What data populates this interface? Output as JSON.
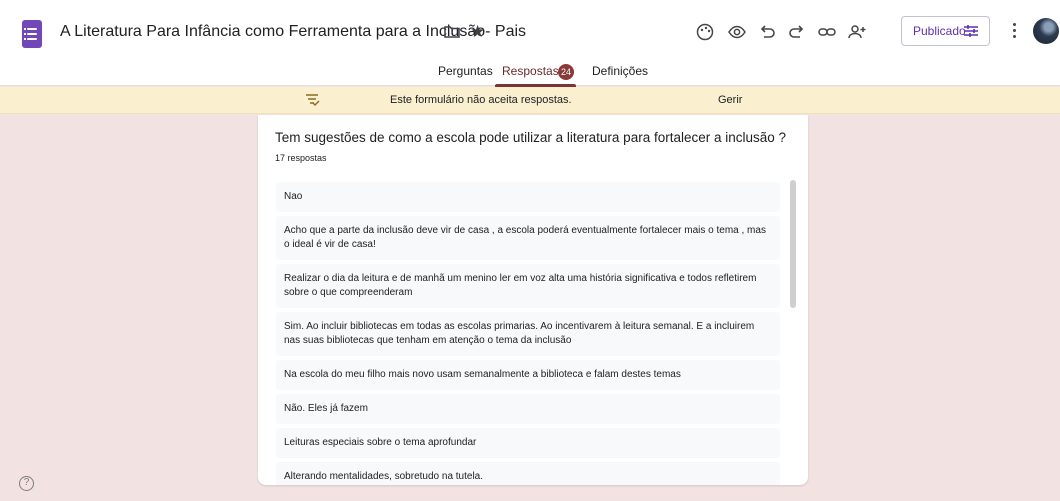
{
  "header": {
    "doc_title": "A Literatura Para  Infância como Ferramenta para a Inclusão- Pais",
    "publish_label": "Publicado"
  },
  "tabs": [
    {
      "label": "Perguntas"
    },
    {
      "label": "Respostas",
      "badge": "24",
      "active": true
    },
    {
      "label": "Definições"
    }
  ],
  "banner": {
    "message": "Este formulário não aceita respostas.",
    "action": "Gerir"
  },
  "question": {
    "title": "Tem sugestões de como a escola pode utilizar a literatura para fortalecer a inclusão ?",
    "count": "17 respostas",
    "answers": [
      "Nao",
      "Acho que a parte da inclusão deve vir de casa , a escola poderá eventualmente fortalecer mais o tema , mas o ideal é vir de casa!",
      "Realizar o dia da leitura e de manhã um menino ler em voz alta uma história significativa e todos refletirem sobre o que compreenderam",
      "Sim. Ao incluir bibliotecas em todas as escolas primarias. Ao incentivarem à leitura semanal. E a incluirem nas suas bibliotecas que tenham em atenção o tema da inclusão",
      "Na escola do meu filho mais novo usam semanalmente a biblioteca e falam destes temas",
      "Não. Eles já fazem",
      "Leituras especiais sobre o tema aprofundar",
      "Alterando mentalidades, sobretudo na tutela."
    ]
  },
  "icons": [
    "forms-app-icon",
    "folder-icon",
    "star-icon",
    "palette-icon",
    "preview-eye-icon",
    "undo-icon",
    "redo-icon",
    "link-icon",
    "add-collaborator-icon",
    "publish-settings-icon",
    "more-vert-icon",
    "avatar",
    "responses-off-icon",
    "help-icon"
  ],
  "colors": {
    "accent": "#7248b9",
    "tab_active": "#7c3535",
    "badge": "#8b3a3a",
    "background": "#f2e2e2",
    "banner": "#faefcf"
  }
}
